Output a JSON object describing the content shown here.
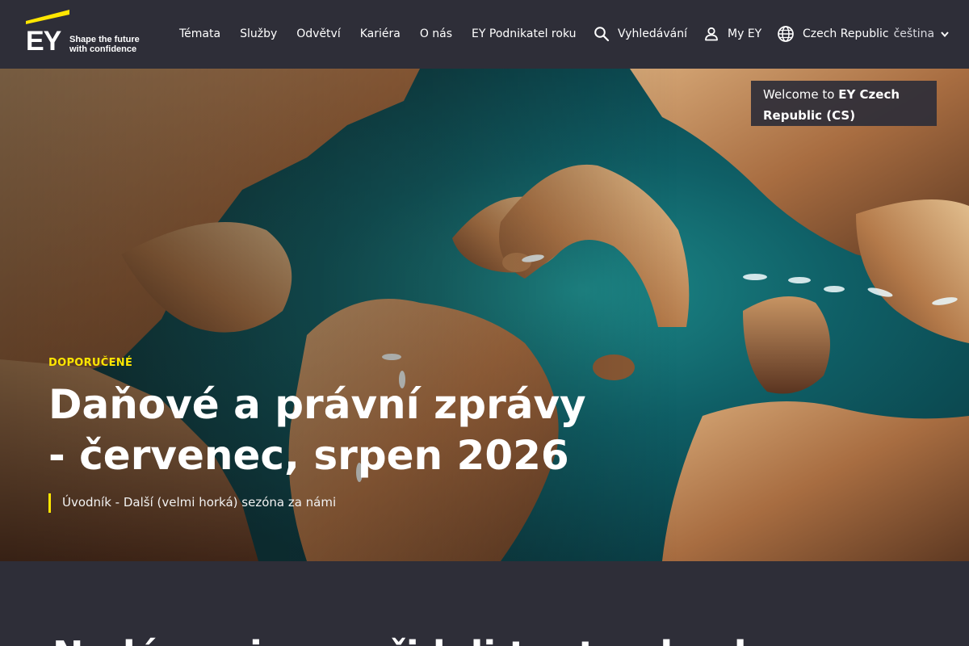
{
  "brand": {
    "logo_text": "EY",
    "tagline": "Shape the future with confidence",
    "accent": "#ffe600",
    "background": "#2e2e38"
  },
  "nav": {
    "items": [
      {
        "label": "Témata"
      },
      {
        "label": "Služby"
      },
      {
        "label": "Odvětví"
      },
      {
        "label": "Kariéra"
      },
      {
        "label": "O nás"
      },
      {
        "label": "EY Podnikatel roku"
      }
    ]
  },
  "utility": {
    "search_label": "Vyhledávání",
    "search_icon": "search-icon",
    "myey_label": "My EY",
    "myey_icon": "user-icon",
    "region_label": "Czech Republic",
    "language_label": "čeština",
    "region_icon": "globe-icon"
  },
  "welcome": {
    "prefix": "Welcome to",
    "site": "EY Czech Republic (CS)"
  },
  "hero": {
    "eyebrow": "DOPORUČENÉ",
    "title": "Daňové a právní zprávy - červenec, srpen 2026",
    "subtitle": "Úvodník - Další (velmi horká) sezóna za námi"
  },
  "below": {
    "title_partial": "Nedávno jsme přidali tento obsah"
  }
}
